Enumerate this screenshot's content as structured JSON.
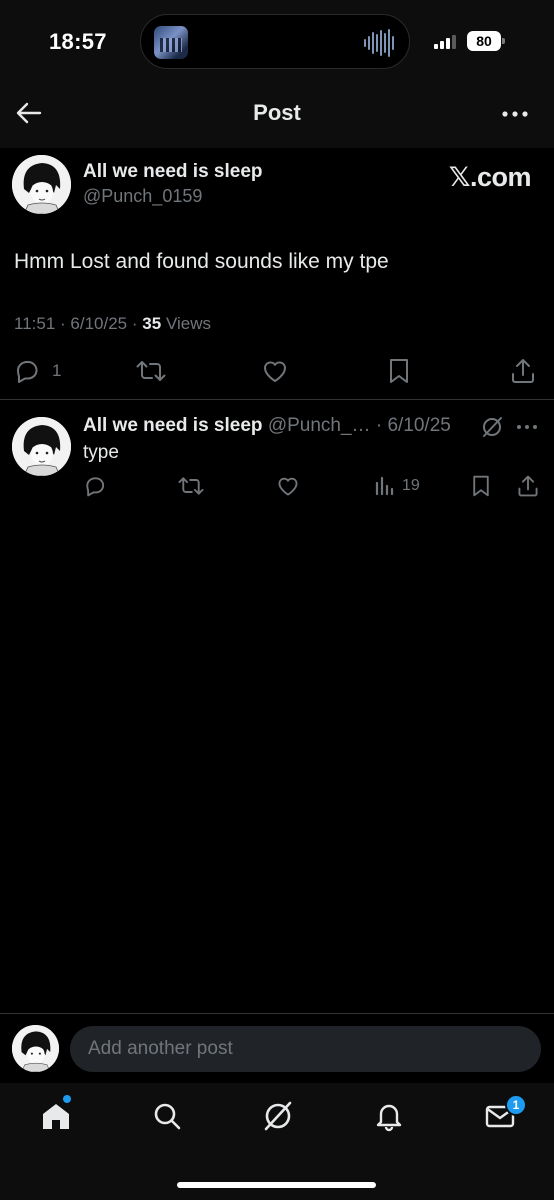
{
  "status_bar": {
    "time": "18:57",
    "battery": "80",
    "icons": [
      "signal-icon",
      "battery-icon",
      "now-playing-waveform-icon"
    ]
  },
  "header": {
    "title": "Post",
    "back_icon": "arrow-left-icon",
    "more_icon": "more-horizontal-icon"
  },
  "main_post": {
    "author_name": "All we need is sleep",
    "handle": "@Punch_0159",
    "watermark": "𝕏.com",
    "text": "Hmm Lost and found sounds like my tpe",
    "time": "11:51",
    "date": "6/10/25",
    "views_count": "35",
    "views_label": "Views",
    "separator": "·",
    "actions": {
      "reply_count": "1"
    }
  },
  "reply": {
    "author_name": "All we need is sleep",
    "handle": "@Punch_…",
    "separator": "·",
    "date": "6/10/25",
    "text": "type",
    "views_count": "19"
  },
  "composer": {
    "placeholder": "Add another post"
  },
  "tab_bar": {
    "tabs": [
      "home",
      "search",
      "grok",
      "notifications",
      "messages"
    ],
    "messages_badge": "1"
  },
  "colors": {
    "background": "#000000",
    "text_primary": "#e7e9ea",
    "text_secondary": "#71767b",
    "accent": "#1d9bf0",
    "divider": "#2f3336"
  }
}
